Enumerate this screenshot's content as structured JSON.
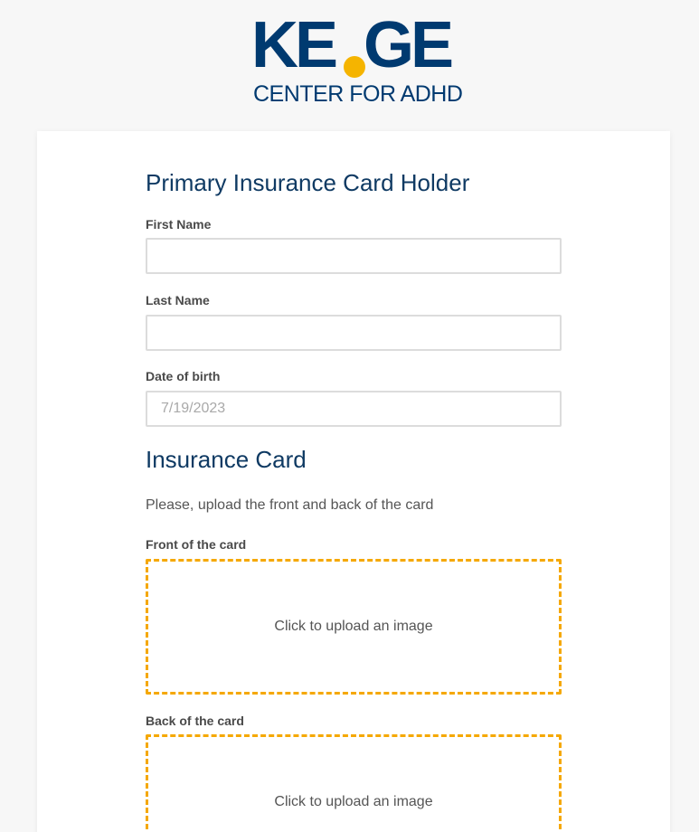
{
  "logo": {
    "wordmark": "KEGE",
    "subtitle": "CENTER FOR ADHD",
    "primary_color": "#003a70",
    "accent_color": "#f5b400"
  },
  "holder_section": {
    "title": "Primary Insurance Card Holder",
    "first_name": {
      "label": "First Name",
      "value": "",
      "placeholder": ""
    },
    "last_name": {
      "label": "Last Name",
      "value": "",
      "placeholder": ""
    },
    "dob": {
      "label": "Date of birth",
      "value": "",
      "placeholder": "7/19/2023"
    }
  },
  "card_section": {
    "title": "Insurance Card",
    "instructions": "Please, upload the front and back of the card",
    "front": {
      "label": "Front of the card",
      "upload_text": "Click to upload an image"
    },
    "back": {
      "label": "Back of the card",
      "upload_text": "Click to upload an image"
    }
  },
  "colors": {
    "heading": "#0f3a63",
    "dropzone_border": "#f5a800",
    "input_border": "#dcdcdc",
    "page_background": "#f7f7f7"
  }
}
